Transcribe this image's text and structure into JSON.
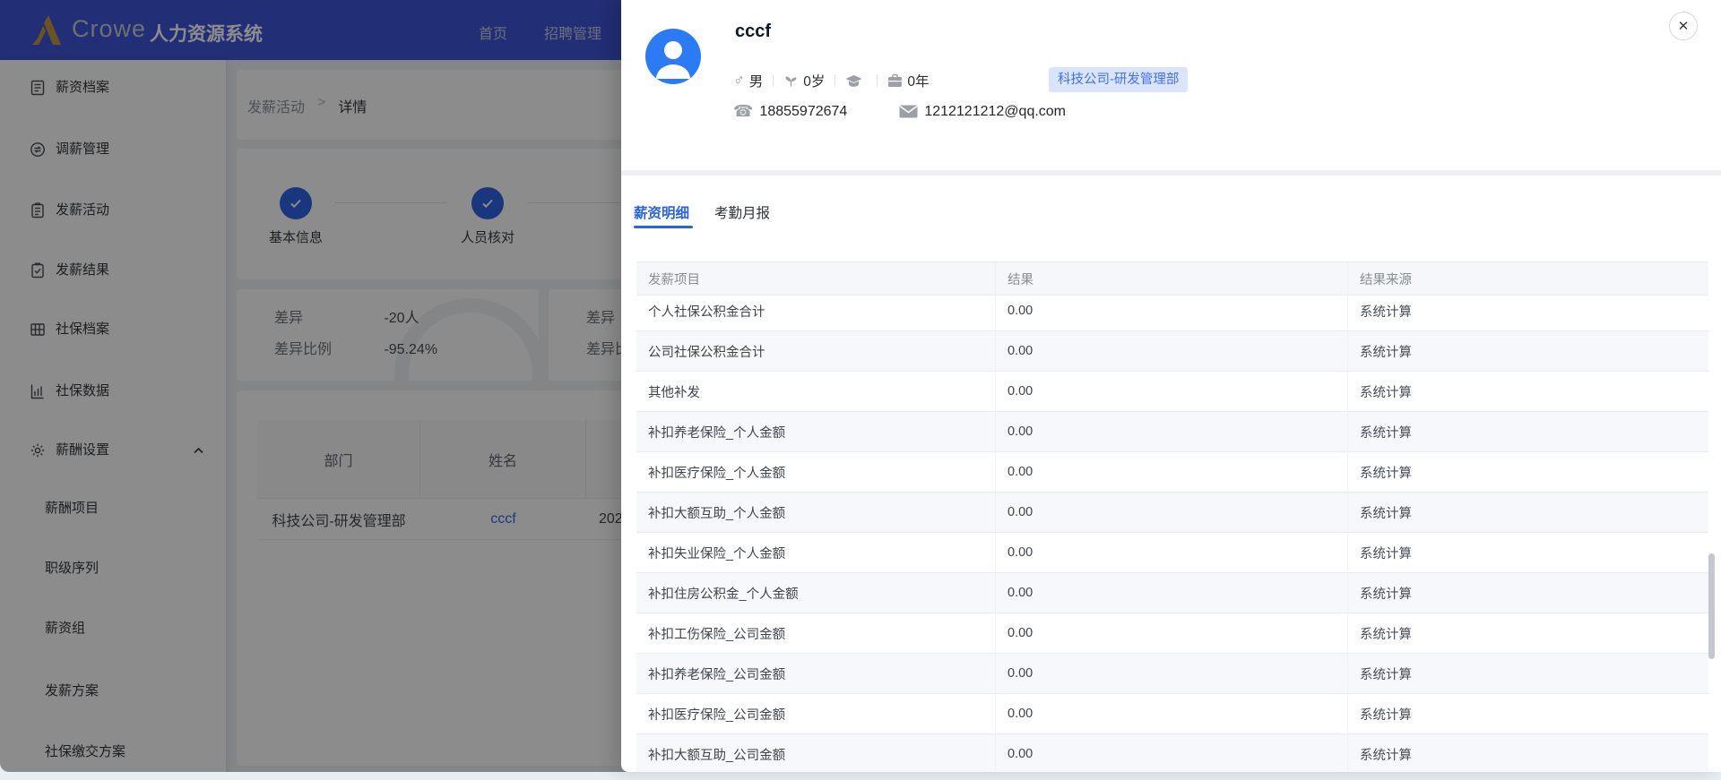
{
  "colors": {
    "primary_blue": "#2e6bf2",
    "navbar_blue": "#3f55d6",
    "logo_gold": "#c59a3e",
    "avatar_blue": "#2b7bf7",
    "tag_bg": "#dae4fb",
    "tag_text": "#3e72f0",
    "active_tab_blue": "#2563ee",
    "mask": "rgba(0,0,0,0.45)"
  },
  "navbar": {
    "brand": "Crowe",
    "title": "人力资源系统",
    "items": [
      {
        "label": "首页"
      },
      {
        "label": "招聘管理"
      }
    ]
  },
  "sidebar": {
    "items": [
      {
        "label": "薪资档案",
        "icon": "file-document-icon",
        "level": 1
      },
      {
        "label": "调薪管理",
        "icon": "exchange-icon",
        "level": 1
      },
      {
        "label": "发薪活动",
        "icon": "clipboard-icon",
        "level": 1
      },
      {
        "label": "发薪结果",
        "icon": "clipboard-check-icon",
        "level": 1
      },
      {
        "label": "社保档案",
        "icon": "archive-icon",
        "level": 1
      },
      {
        "label": "社保数据",
        "icon": "bar-chart-icon",
        "level": 1
      },
      {
        "label": "薪酬设置",
        "icon": "gear-icon",
        "level": 1,
        "expanded": true
      },
      {
        "label": "薪酬项目",
        "level": 2
      },
      {
        "label": "职级序列",
        "level": 2
      },
      {
        "label": "薪资组",
        "level": 2
      },
      {
        "label": "发薪方案",
        "level": 2
      },
      {
        "label": "社保缴交方案",
        "level": 2
      }
    ]
  },
  "breadcrumb": {
    "items": [
      "发薪活动",
      "详情"
    ],
    "separator": ">"
  },
  "steps": [
    {
      "label": "基本信息",
      "status": "finished"
    },
    {
      "label": "人员核对",
      "status": "finished"
    }
  ],
  "stats": {
    "card1": {
      "rows": [
        {
          "label": "差异",
          "value": "-20人"
        },
        {
          "label": "差异比例",
          "value": "-95.24%"
        }
      ]
    },
    "card2": {
      "rows": [
        {
          "label": "差异",
          "value": ""
        },
        {
          "label": "差异比例",
          "value": ""
        }
      ]
    }
  },
  "main_table": {
    "columns": [
      "部门",
      "姓名"
    ],
    "row": {
      "department": "科技公司-研发管理部",
      "name": "cccf",
      "third_cell_visible": "202"
    }
  },
  "drawer": {
    "close_glyph": "✕",
    "profile": {
      "name": "cccf",
      "gender": "男",
      "age": "0岁",
      "seniority": "0年",
      "department_tag": "科技公司-研发管理部",
      "phone": "18855972674",
      "email": "1212121212@qq.com"
    },
    "tabs": [
      {
        "label": "薪资明细",
        "active": true
      },
      {
        "label": "考勤月报",
        "active": false
      }
    ],
    "salary_table": {
      "columns": [
        "发薪项目",
        "结果",
        "结果来源"
      ],
      "rows": [
        [
          "个人社保公积金合计",
          "0.00",
          "系统计算"
        ],
        [
          "公司社保公积金合计",
          "0.00",
          "系统计算"
        ],
        [
          "其他补发",
          "0.00",
          "系统计算"
        ],
        [
          "补扣养老保险_个人金额",
          "0.00",
          "系统计算"
        ],
        [
          "补扣医疗保险_个人金额",
          "0.00",
          "系统计算"
        ],
        [
          "补扣大额互助_个人金额",
          "0.00",
          "系统计算"
        ],
        [
          "补扣失业保险_个人金额",
          "0.00",
          "系统计算"
        ],
        [
          "补扣住房公积金_个人金额",
          "0.00",
          "系统计算"
        ],
        [
          "补扣工伤保险_公司金额",
          "0.00",
          "系统计算"
        ],
        [
          "补扣养老保险_公司金额",
          "0.00",
          "系统计算"
        ],
        [
          "补扣医疗保险_公司金额",
          "0.00",
          "系统计算"
        ],
        [
          "补扣大额互助_公司金额",
          "0.00",
          "系统计算"
        ]
      ]
    }
  }
}
